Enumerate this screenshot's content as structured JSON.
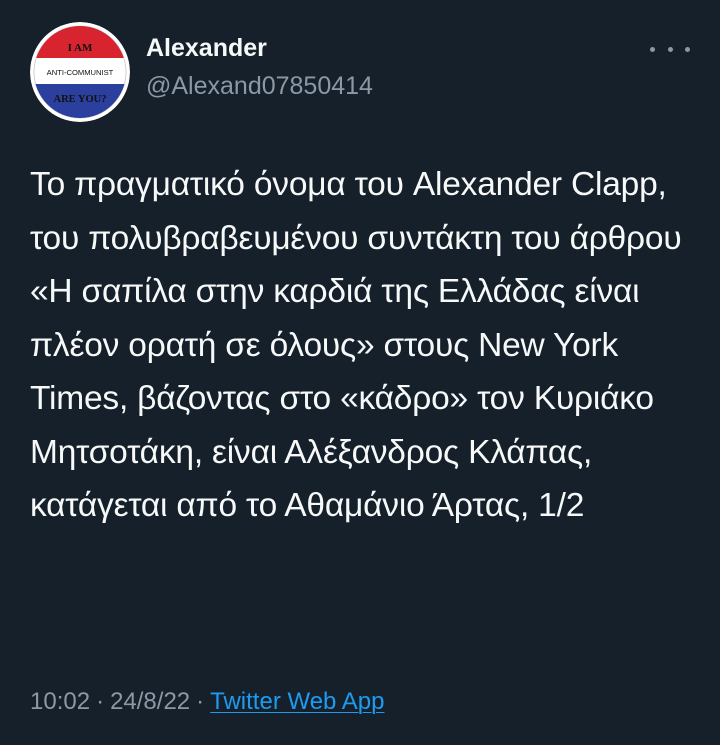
{
  "colors": {
    "background": "#15202b",
    "primary_text": "#f7f9f9",
    "secondary_text": "#8b98a5",
    "link": "#1d9bf0",
    "badge_red": "#d8242f",
    "badge_blue": "#2b3f9e"
  },
  "author": {
    "avatar_text_top": "I AM",
    "avatar_text_middle": "ANTI-COMMUNIST",
    "avatar_text_bottom": "ARE YOU?",
    "display_name": "Alexander",
    "handle": "@Alexand07850414"
  },
  "more_icon": "more-horizontal-icon",
  "tweet": {
    "text": "Το πραγματικό όνομα του Alexander Clapp, του πολυβραβευμένου συντάκτη του άρθρου «Η σαπίλα στην καρδιά της Ελλάδας είναι πλέον ορατή σε όλους» στους New York Times, βάζοντας στο «κάδρο» τον Κυριάκο Μητσοτάκη, είναι Αλέξανδρος Κλάπας, κατάγεται από το Αθαμάνιο Άρτας, 1/2"
  },
  "meta": {
    "time": "10:02",
    "separator": "·",
    "date": "24/8/22",
    "source": "Twitter Web App"
  }
}
